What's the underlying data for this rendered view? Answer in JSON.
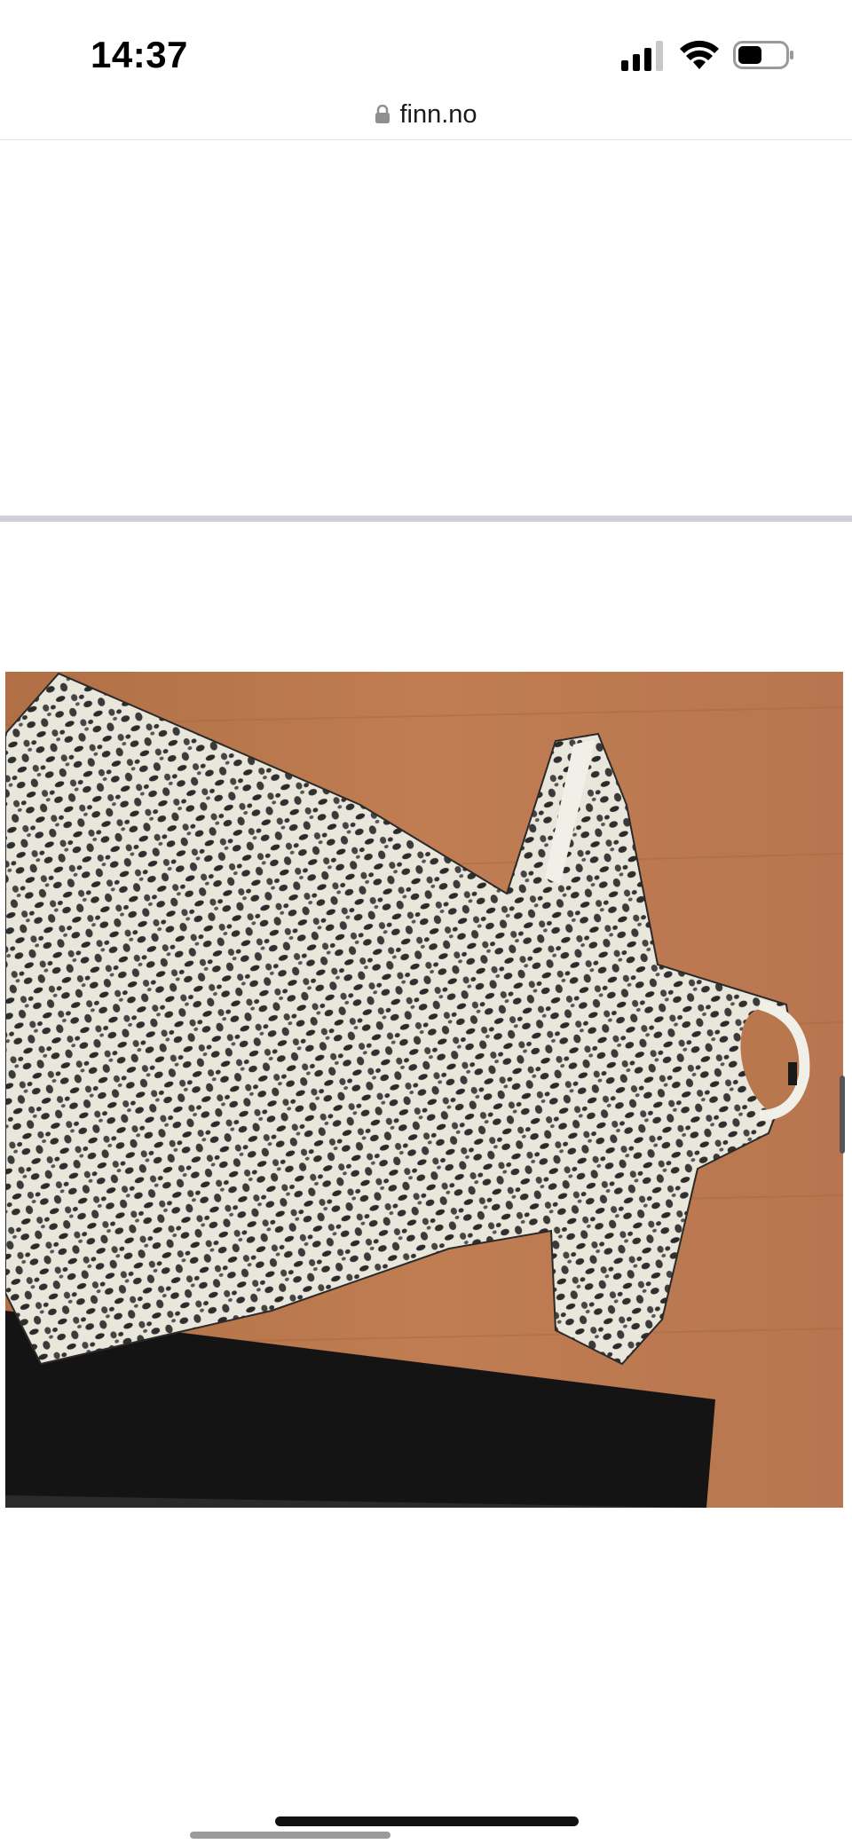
{
  "status_bar": {
    "time": "14:37",
    "signal_icon": "cellular-signal-icon",
    "wifi_icon": "wifi-icon",
    "battery_icon": "battery-icon",
    "battery_level": 0.5
  },
  "browser": {
    "lock_icon": "lock-icon",
    "url": "finn.no"
  },
  "gallery": {
    "image_alt": "",
    "colors": {
      "floor": "#b9774e",
      "garment_base": "#e9e6dc",
      "garment_spots": "#2f2f2f",
      "trousers": "#141414"
    }
  }
}
